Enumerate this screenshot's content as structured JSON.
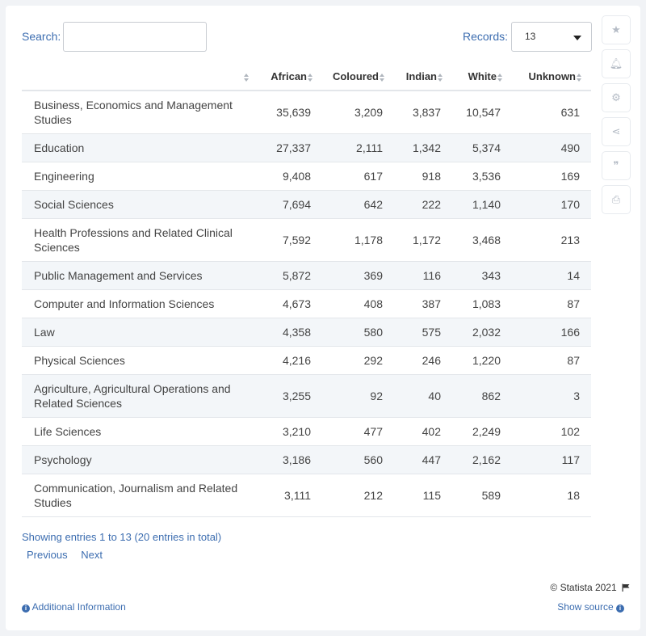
{
  "search": {
    "label": "Search:",
    "value": ""
  },
  "records": {
    "label": "Records:",
    "value": "13"
  },
  "tools": [
    {
      "icon": "star-icon",
      "glyph": "★"
    },
    {
      "icon": "bell-icon",
      "glyph": "🔔︎"
    },
    {
      "icon": "gear-icon",
      "glyph": "⚙"
    },
    {
      "icon": "share-icon",
      "glyph": "⋖"
    },
    {
      "icon": "quote-icon",
      "glyph": "❞"
    },
    {
      "icon": "print-icon",
      "glyph": "⎙"
    }
  ],
  "chart_data": {
    "type": "table",
    "columns": [
      "",
      "African",
      "Coloured",
      "Indian",
      "White",
      "Unknown"
    ],
    "rows": [
      {
        "category": "Business, Economics and Management Studies",
        "values": [
          "35,639",
          "3,209",
          "3,837",
          "10,547",
          "631"
        ]
      },
      {
        "category": "Education",
        "values": [
          "27,337",
          "2,111",
          "1,342",
          "5,374",
          "490"
        ]
      },
      {
        "category": "Engineering",
        "values": [
          "9,408",
          "617",
          "918",
          "3,536",
          "169"
        ]
      },
      {
        "category": "Social Sciences",
        "values": [
          "7,694",
          "642",
          "222",
          "1,140",
          "170"
        ]
      },
      {
        "category": "Health Professions and Related Clinical Sciences",
        "values": [
          "7,592",
          "1,178",
          "1,172",
          "3,468",
          "213"
        ]
      },
      {
        "category": "Public Management and Services",
        "values": [
          "5,872",
          "369",
          "116",
          "343",
          "14"
        ]
      },
      {
        "category": "Computer and Information Sciences",
        "values": [
          "4,673",
          "408",
          "387",
          "1,083",
          "87"
        ]
      },
      {
        "category": "Law",
        "values": [
          "4,358",
          "580",
          "575",
          "2,032",
          "166"
        ]
      },
      {
        "category": "Physical Sciences",
        "values": [
          "4,216",
          "292",
          "246",
          "1,220",
          "87"
        ]
      },
      {
        "category": "Agriculture, Agricultural Operations and Related Sciences",
        "values": [
          "3,255",
          "92",
          "40",
          "862",
          "3"
        ]
      },
      {
        "category": "Life Sciences",
        "values": [
          "3,210",
          "477",
          "402",
          "2,249",
          "102"
        ]
      },
      {
        "category": "Psychology",
        "values": [
          "3,186",
          "560",
          "447",
          "2,162",
          "117"
        ]
      },
      {
        "category": "Communication, Journalism and Related Studies",
        "values": [
          "3,111",
          "212",
          "115",
          "589",
          "18"
        ]
      }
    ]
  },
  "footer": {
    "showing": "Showing entries 1 to 13 (20 entries in total)",
    "previous": "Previous",
    "next": "Next",
    "credit": "© Statista 2021",
    "additional_info": "Additional Information",
    "show_source": "Show source"
  },
  "colors": {
    "accent": "#3c6db0",
    "row_alt": "#f3f6f9",
    "border": "#e3e6ea"
  }
}
